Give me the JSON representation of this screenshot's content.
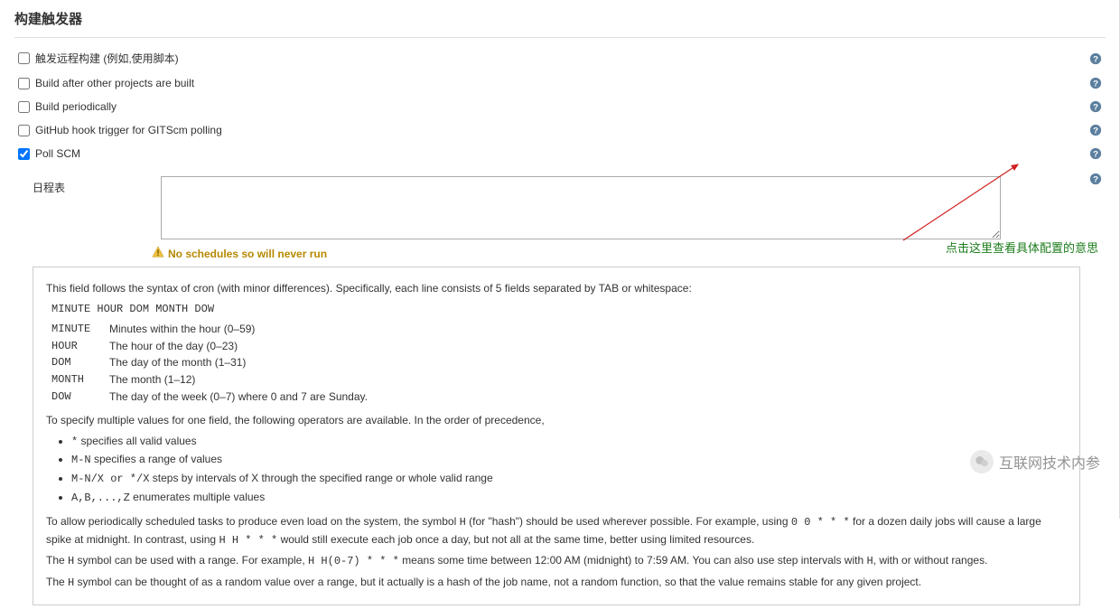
{
  "section_title": "构建触发器",
  "triggers": [
    {
      "label": "触发远程构建 (例如,使用脚本)",
      "checked": false
    },
    {
      "label": "Build after other projects are built",
      "checked": false
    },
    {
      "label": "Build periodically",
      "checked": false
    },
    {
      "label": "GitHub hook trigger for GITScm polling",
      "checked": false
    },
    {
      "label": "Poll SCM",
      "checked": true
    }
  ],
  "schedule": {
    "label": "日程表",
    "value": "",
    "warning": "No schedules so will never run"
  },
  "annotation": "点击这里查看具体配置的意思",
  "help": {
    "intro": "This field follows the syntax of cron (with minor differences). Specifically, each line consists of 5 fields separated by TAB or whitespace:",
    "syntax_line": "MINUTE HOUR DOM MONTH DOW",
    "fields": [
      {
        "k": "MINUTE",
        "v": "Minutes within the hour (0–59)"
      },
      {
        "k": "HOUR",
        "v": "The hour of the day (0–23)"
      },
      {
        "k": "DOM",
        "v": "The day of the month (1–31)"
      },
      {
        "k": "MONTH",
        "v": "The month (1–12)"
      },
      {
        "k": "DOW",
        "v": "The day of the week (0–7) where 0 and 7 are Sunday."
      }
    ],
    "operators_intro": "To specify multiple values for one field, the following operators are available. In the order of precedence,",
    "operators": [
      {
        "pre": "*",
        "post": " specifies all valid values"
      },
      {
        "pre": "M-N",
        "post": " specifies a range of values"
      },
      {
        "pre": "M-N/X or */X",
        "post": " steps by intervals of X through the specified range or whole valid range"
      },
      {
        "pre": "A,B,...,Z",
        "post": " enumerates multiple values"
      }
    ],
    "hash_p1a": "To allow periodically scheduled tasks to produce even load on the system, the symbol ",
    "hash_p1code1": "H",
    "hash_p1b": " (for \"hash\") should be used wherever possible. For example, using ",
    "hash_p1code2": "0 0 * * *",
    "hash_p1c": " for a dozen daily jobs will cause a large spike at midnight. In contrast, using ",
    "hash_p1code3": "H H * * *",
    "hash_p1d": " would still execute each job once a day, but not all at the same time, better using limited resources.",
    "hash_p2a": "The ",
    "hash_p2code1": "H",
    "hash_p2b": " symbol can be used with a range. For example, ",
    "hash_p2code2": "H H(0-7) * * *",
    "hash_p2c": " means some time between 12:00 AM (midnight) to 7:59 AM. You can also use step intervals with ",
    "hash_p2code3": "H",
    "hash_p2d": ", with or without ranges.",
    "hash_p3a": "The ",
    "hash_p3code1": "H",
    "hash_p3b": " symbol can be thought of as a random value over a range, but it actually is a hash of the job name, not a random function, so that the value remains stable for any given project."
  },
  "watermark": "互联网技术内参"
}
